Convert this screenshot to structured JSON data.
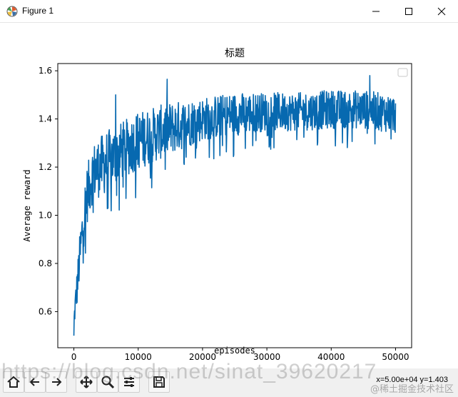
{
  "window": {
    "title": "Figure 1",
    "icon": "matplotlib-icon",
    "controls": [
      "minimize-icon",
      "maximize-icon",
      "close-icon"
    ]
  },
  "chart_data": {
    "type": "line",
    "title": "标题",
    "xlabel": "episodes",
    "ylabel": "Average reward",
    "xlim": [
      -2500,
      52500
    ],
    "ylim": [
      0.45,
      1.63
    ],
    "xticks": [
      0,
      10000,
      20000,
      30000,
      40000,
      50000
    ],
    "xtick_labels": [
      "0",
      "10000",
      "20000",
      "30000",
      "40000",
      "50000"
    ],
    "yticks": [
      0.6,
      0.8,
      1.0,
      1.2,
      1.4,
      1.6
    ],
    "ytick_labels": [
      "0.6",
      "0.8",
      "1.0",
      "1.2",
      "1.4",
      "1.6"
    ],
    "grid": false,
    "legend": "top-right (empty)",
    "color": "#0769b0",
    "series": [
      {
        "x_start": 0,
        "x_end": 50000,
        "envelope": {
          "x": [
            0,
            250,
            500,
            1000,
            1500,
            2000,
            3000,
            5000,
            7000,
            10000,
            15000,
            20000,
            25000,
            30000,
            35000,
            40000,
            45000,
            50000
          ],
          "mean": [
            0.55,
            0.64,
            0.7,
            0.85,
            0.98,
            1.08,
            1.18,
            1.22,
            1.26,
            1.31,
            1.36,
            1.4,
            1.42,
            1.43,
            1.43,
            1.44,
            1.44,
            1.42
          ],
          "spread": [
            0.04,
            0.06,
            0.08,
            0.1,
            0.12,
            0.12,
            0.12,
            0.13,
            0.12,
            0.12,
            0.11,
            0.09,
            0.09,
            0.08,
            0.08,
            0.08,
            0.08,
            0.08
          ]
        },
        "notable_points": [
          [
            0,
            0.5
          ],
          [
            6500,
            1.5
          ],
          [
            14500,
            1.565
          ],
          [
            46000,
            1.58
          ]
        ]
      }
    ]
  },
  "toolbar": {
    "tools": [
      {
        "icon": "home-icon",
        "label": "Home"
      },
      {
        "icon": "back-arrow-icon",
        "label": "Back"
      },
      {
        "icon": "forward-arrow-icon",
        "label": "Forward"
      },
      {
        "icon": "pan-icon",
        "label": "Pan"
      },
      {
        "icon": "zoom-icon",
        "label": "Zoom"
      },
      {
        "icon": "subplots-icon",
        "label": "Configure subplots"
      },
      {
        "icon": "save-icon",
        "label": "Save"
      }
    ],
    "coords_text": "x=5.00e+04 y=1.403"
  },
  "watermark": {
    "text": "https://blog.csdn.net/sinat_39620217",
    "text2": "@稀土掘金技术社区"
  }
}
